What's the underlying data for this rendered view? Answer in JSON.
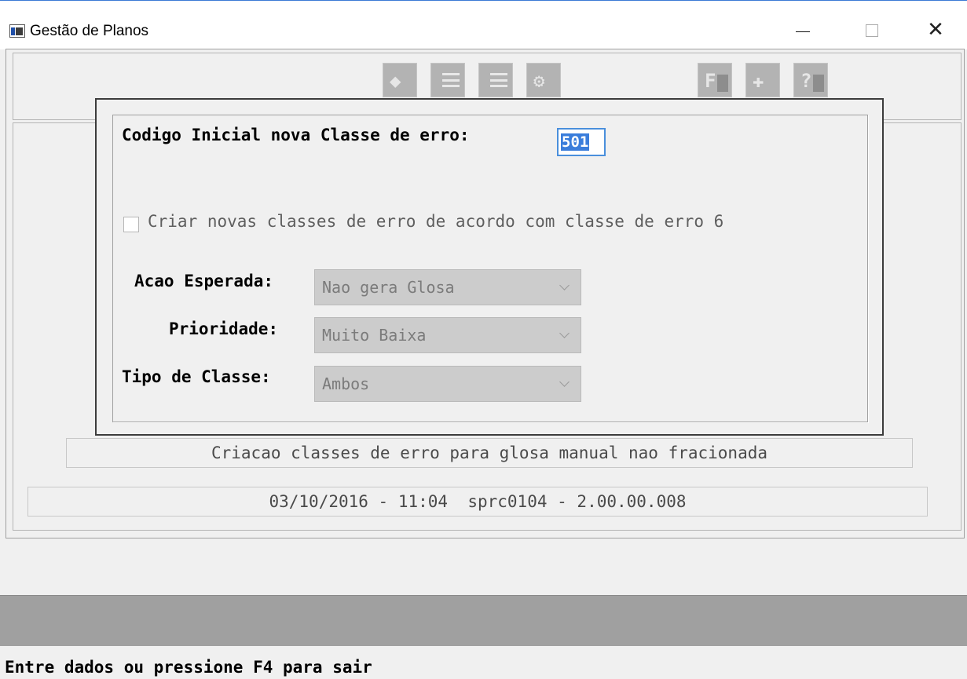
{
  "window": {
    "title": "Gestão de Planos",
    "minimize_icon": "minimize-icon",
    "maximize_icon": "maximize-icon",
    "close_glyph": "✕"
  },
  "toolbar": {
    "buttons": [
      {
        "icon": "edit-icon",
        "glyph": "◆"
      },
      {
        "icon": "list-icon",
        "glyph": "≡"
      },
      {
        "icon": "checklist-icon",
        "glyph": "☑"
      },
      {
        "icon": "gears-icon",
        "glyph": "⚙"
      },
      {
        "icon": "f-key-icon",
        "glyph": "F"
      },
      {
        "icon": "exit-icon",
        "glyph": "✚"
      },
      {
        "icon": "help-icon",
        "glyph": "?"
      }
    ]
  },
  "dialog": {
    "code_label": "Codigo Inicial nova Classe de erro:",
    "code_value": "501",
    "checkbox_label": "Criar novas classes de erro de acordo com classe de erro 6",
    "checkbox_checked": false,
    "acao_label": "Acao Esperada:",
    "acao_value": "Nao gera Glosa",
    "prioridade_label": "Prioridade:",
    "prioridade_value": "Muito Baixa",
    "tipo_label": "Tipo de Classe:",
    "tipo_value": "Ambos"
  },
  "info": "Criacao classes de erro para glosa manual nao fracionada",
  "version": "03/10/2016 - 11:04  sprc0104 - 2.00.00.008",
  "status": "Entre dados ou pressione F4 para sair",
  "colors": {
    "accent": "#3a7ddb",
    "background": "#f0f0f0",
    "status_bar": "#a0a0a0"
  }
}
